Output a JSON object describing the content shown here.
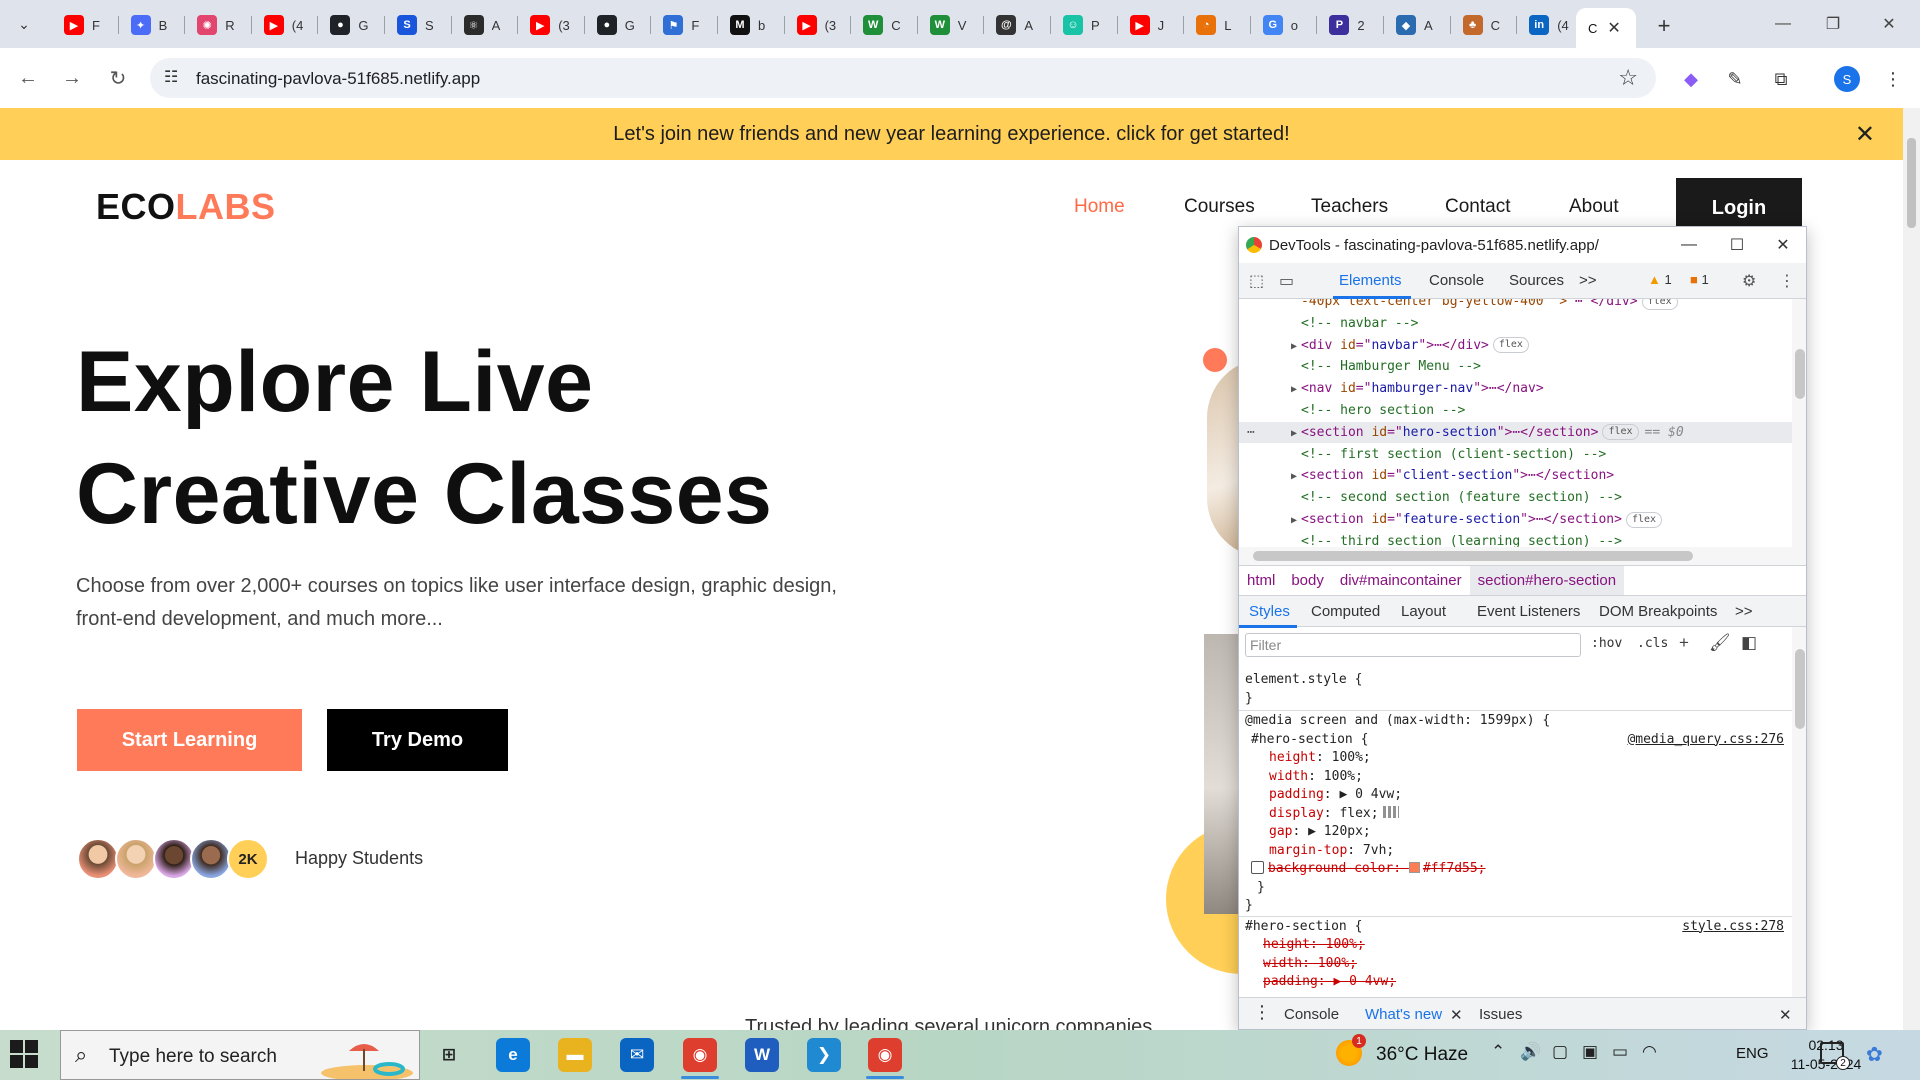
{
  "browser": {
    "tabs": [
      {
        "title": "F",
        "icon": "youtube-icon",
        "color": "#ff0000",
        "glyph": "▶"
      },
      {
        "title": "B",
        "icon": "bard-icon",
        "color": "#4a6cf7",
        "glyph": "✦"
      },
      {
        "title": "R",
        "icon": "react-icon",
        "color": "#e2466f",
        "glyph": "✺"
      },
      {
        "title": "(4",
        "icon": "youtube-icon",
        "color": "#ff0000",
        "glyph": "▶"
      },
      {
        "title": "G",
        "icon": "github-icon",
        "color": "#1f2328",
        "glyph": "●"
      },
      {
        "title": "S",
        "icon": "s-icon",
        "color": "#1a56db",
        "glyph": "S"
      },
      {
        "title": "A",
        "icon": "atom-icon",
        "color": "#2b2b2b",
        "glyph": "⚛"
      },
      {
        "title": "(3",
        "icon": "youtube-icon",
        "color": "#ff0000",
        "glyph": "▶"
      },
      {
        "title": "G",
        "icon": "github-icon",
        "color": "#1f2328",
        "glyph": "●"
      },
      {
        "title": "F",
        "icon": "flag-icon",
        "color": "#2f6fd6",
        "glyph": "⚑"
      },
      {
        "title": "b",
        "icon": "medium-icon",
        "color": "#111111",
        "glyph": "M"
      },
      {
        "title": "(3",
        "icon": "youtube-icon",
        "color": "#ff0000",
        "glyph": "▶"
      },
      {
        "title": "C",
        "icon": "w-green-icon",
        "color": "#1f8f3a",
        "glyph": "W"
      },
      {
        "title": "V",
        "icon": "w-green-icon",
        "color": "#1f8f3a",
        "glyph": "W"
      },
      {
        "title": "A",
        "icon": "a-circle-icon",
        "color": "#333333",
        "glyph": "@"
      },
      {
        "title": "P",
        "icon": "copilot-icon",
        "color": "#19c3a6",
        "glyph": "☺"
      },
      {
        "title": "J",
        "icon": "youtube-icon",
        "color": "#ff0000",
        "glyph": "▶"
      },
      {
        "title": "L",
        "icon": "chrome-l-icon",
        "color": "#e8710a",
        "glyph": "◔"
      },
      {
        "title": "o",
        "icon": "google-icon",
        "color": "#4285f4",
        "glyph": "G"
      },
      {
        "title": "2",
        "icon": "pu-icon",
        "color": "#3a2f9c",
        "glyph": "P"
      },
      {
        "title": "A",
        "icon": "shield-icon",
        "color": "#2b6cb0",
        "glyph": "◆"
      },
      {
        "title": "C",
        "icon": "tree-icon",
        "color": "#c2692b",
        "glyph": "♣"
      },
      {
        "title": "(4",
        "icon": "linkedin-icon",
        "color": "#0a66c2",
        "glyph": "in"
      }
    ],
    "active_tab": {
      "title": "C"
    },
    "url": "fascinating-pavlova-51f685.netlify.app",
    "profile_initial": "S"
  },
  "page": {
    "banner": "Let's join new friends and new year learning experience. click for get started!",
    "logo": {
      "part1": "ECO",
      "part2": "LABS"
    },
    "nav": [
      {
        "label": "Home",
        "active": true
      },
      {
        "label": "Courses",
        "active": false
      },
      {
        "label": "Teachers",
        "active": false
      },
      {
        "label": "Contact",
        "active": false
      },
      {
        "label": "About",
        "active": false
      }
    ],
    "login": "Login",
    "hero": {
      "title_line1": "Explore Live",
      "title_line2": "Creative Classes",
      "description": "Choose from over 2,000+ courses on topics like user interface design, graphic design, front-end development, and much more...",
      "btn_primary": "Start Learning",
      "btn_secondary": "Try Demo",
      "students_count": "2K",
      "students_label": "Happy Students"
    },
    "trusted_text": "Trusted by leading several unicorn companies",
    "colors": {
      "accent": "#ff7a59",
      "banner": "#ffcf57",
      "dark": "#1a1a1a"
    }
  },
  "devtools": {
    "title": "DevTools - fascinating-pavlova-51f685.netlify.app/",
    "tabs": [
      "Elements",
      "Console",
      "Sources"
    ],
    "more_tabs": ">>",
    "warnings": "1",
    "errors": "1",
    "dom_lines": [
      {
        "type": "partial",
        "text": "-40px text-center bg-yellow-400\" >",
        "tail": "</div>",
        "badge": "flex"
      },
      {
        "type": "comment",
        "text": "<!-- navbar -->"
      },
      {
        "type": "element",
        "tag": "div",
        "attr": "id",
        "val": "navbar",
        "close": "div",
        "badge": "flex"
      },
      {
        "type": "comment",
        "text": "<!-- Hamburger Menu -->"
      },
      {
        "type": "element",
        "tag": "nav",
        "attr": "id",
        "val": "hamburger-nav",
        "close": "nav",
        "badge": ""
      },
      {
        "type": "comment",
        "text": "<!-- hero section -->"
      },
      {
        "type": "element",
        "tag": "section",
        "attr": "id",
        "val": "hero-section",
        "close": "section",
        "badge": "flex",
        "selected": true,
        "suffix": "== $0"
      },
      {
        "type": "comment",
        "text": "<!-- first section (client-section) -->"
      },
      {
        "type": "element",
        "tag": "section",
        "attr": "id",
        "val": "client-section",
        "close": "section",
        "badge": ""
      },
      {
        "type": "comment",
        "text": "<!-- second section (feature section) -->"
      },
      {
        "type": "element",
        "tag": "section",
        "attr": "id",
        "val": "feature-section",
        "close": "section",
        "badge": "flex"
      },
      {
        "type": "comment",
        "text": "<!-- third section (learning section) -->"
      }
    ],
    "breadcrumbs": [
      "html",
      "body",
      "div#maincontainer",
      "section#hero-section"
    ],
    "sub_tabs": [
      "Styles",
      "Computed",
      "Layout",
      "Event Listeners",
      "DOM Breakpoints"
    ],
    "filter_placeholder": "Filter",
    "hov": ":hov",
    "cls": ".cls",
    "styles": {
      "element_style": "element.style {",
      "media": "@media screen and (max-width: 1599px) {",
      "rule1_selector": "#hero-section {",
      "rule1_source": "@media_query.css:276",
      "rule1_props": [
        {
          "prop": "height",
          "value": "100%;"
        },
        {
          "prop": "width",
          "value": "100%;"
        },
        {
          "prop": "padding",
          "value": "▶ 0 4vw;"
        },
        {
          "prop": "display",
          "value": "flex;"
        },
        {
          "prop": "gap",
          "value": "▶ 120px;"
        },
        {
          "prop": "margin-top",
          "value": "7vh;"
        }
      ],
      "rule1_disabled": {
        "prop": "background-color",
        "value": "#ff7d55;",
        "color": "#ff7d55"
      },
      "rule2_selector": "#hero-section {",
      "rule2_source": "style.css:278",
      "rule2_props": [
        {
          "prop": "height",
          "value": "100%;"
        },
        {
          "prop": "width",
          "value": "100%;"
        },
        {
          "prop": "padding",
          "value": "▶ 0 4vw;"
        }
      ]
    },
    "drawer_tabs": [
      "Console",
      "What's new",
      "Issues"
    ]
  },
  "taskbar": {
    "search_placeholder": "Type here to search",
    "apps": [
      {
        "name": "task-view-icon",
        "glyph": "⊞",
        "color": "transparent"
      },
      {
        "name": "edge-icon",
        "glyph": "e",
        "color": "#0c7ad8"
      },
      {
        "name": "file-explorer-icon",
        "glyph": "▬",
        "color": "#e9b320"
      },
      {
        "name": "mail-icon",
        "glyph": "✉",
        "color": "#0a64c2"
      },
      {
        "name": "chrome-profile-icon",
        "glyph": "◉",
        "color": "#de3e2e"
      },
      {
        "name": "word-icon",
        "glyph": "W",
        "color": "#1f5dbf"
      },
      {
        "name": "vscode-icon",
        "glyph": "❯",
        "color": "#1f8ad2"
      },
      {
        "name": "chrome-icon",
        "glyph": "◉",
        "color": "#de3e2e"
      }
    ],
    "weather": "36°C  Haze",
    "weather_badge": "1",
    "lang": "ENG",
    "time": "02:13",
    "date": "11-05-2024",
    "notifications": "2"
  }
}
